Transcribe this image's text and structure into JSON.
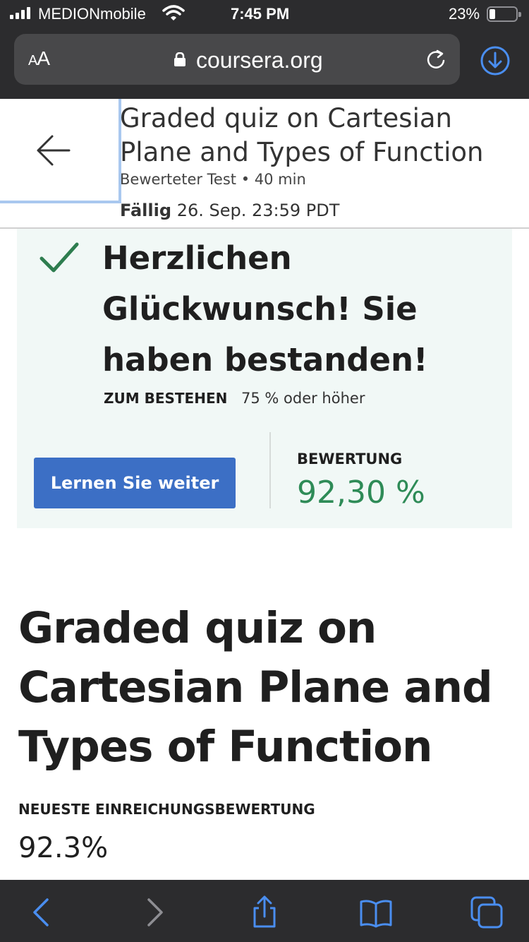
{
  "status_bar": {
    "carrier": "MEDIONmobile",
    "time": "7:45 PM",
    "battery_percent": "23%",
    "battery_level": 0.23
  },
  "browser": {
    "text_size_label_small": "A",
    "text_size_label_large": "A",
    "domain": "coursera.org",
    "icons": [
      "lock-icon",
      "reload-icon",
      "download-icon"
    ]
  },
  "course_header": {
    "title": "Graded quiz on Cartesian Plane and Types of Function",
    "meta": "Bewerteter Test • 40 min",
    "due_label": "Fällig",
    "due_value": "26. Sep. 23:59 PDT"
  },
  "result_panel": {
    "message": "Herzlichen Glückwunsch! Sie haben bestanden!",
    "pass_label": "ZUM BESTEHEN",
    "pass_value": "75 % oder höher",
    "cta_label": "Lernen Sie weiter",
    "grade_label": "BEWERTUNG",
    "grade_value": "92,30 %"
  },
  "main": {
    "title": "Graded quiz on Cartesian Plane and Types of Function",
    "latest_label": "NEUESTE EINREICHUNGSBEWERTUNG",
    "latest_value": "92.3%"
  },
  "toolbar": {
    "icons": [
      "back-icon",
      "forward-icon",
      "share-icon",
      "bookmarks-icon",
      "tabs-icon"
    ]
  },
  "colors": {
    "chrome": "#2c2c2e",
    "accent_blue": "#3c6fc5",
    "success_green": "#2e8b57",
    "panel_bg": "#f1f8f6",
    "toolbar_icon": "#4a8ef0"
  }
}
